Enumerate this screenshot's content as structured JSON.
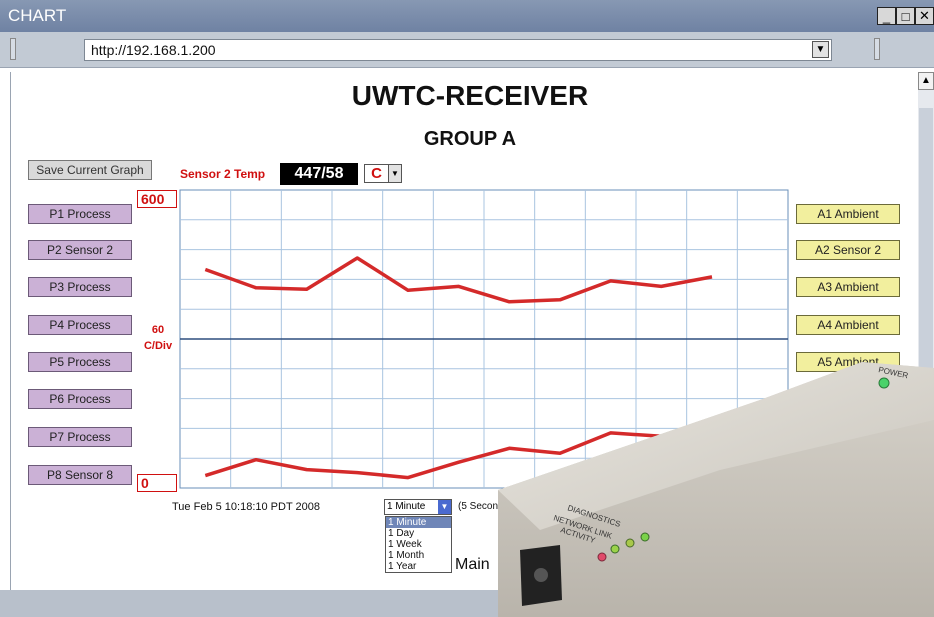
{
  "window": {
    "title": "CHART",
    "controls": [
      "_",
      "□",
      "✕"
    ],
    "address": "http://192.168.1.200"
  },
  "page": {
    "title": "UWTC-RECEIVER",
    "subtitle": "GROUP A",
    "save_button": "Save Current Graph",
    "sensor_label": "Sensor 2 Temp",
    "sensor_value": "447/58",
    "unit": "C",
    "y_top": "600",
    "y_bottom": "0",
    "y_div_value": "60",
    "y_div_unit": "C/Div",
    "timestamp": "Tue Feb 5 10:18:10 PDT 2008",
    "range_selected": "1 Minute",
    "range_note": "(5 Seconds/Div)",
    "range_options": [
      "1 Minute",
      "1 Day",
      "1 Week",
      "1 Month",
      "1 Year"
    ],
    "main_link": "Main"
  },
  "left_buttons": [
    "P1 Process",
    "P2 Sensor 2",
    "P3 Process",
    "P4 Process",
    "P5 Process",
    "P6 Process",
    "P7 Process",
    "P8 Sensor 8"
  ],
  "right_buttons": [
    "A1 Ambient",
    "A2 Sensor 2",
    "A3 Ambient",
    "A4 Ambient",
    "A5 Ambient"
  ],
  "device_labels": {
    "power": "POWER",
    "diagnostics": "DIAGNOSTICS",
    "network_link": "NETWORK LINK",
    "activity": "ACTIVITY"
  },
  "colors": {
    "trace": "#d42a2a",
    "grid": "#a9c4e0",
    "process_button": "#cbb1d6",
    "ambient_button": "#f2ef9e"
  },
  "chart_data": {
    "type": "line",
    "ylim": [
      0,
      600
    ],
    "y_step": 60,
    "x_divisions": 12,
    "x_step_seconds": 5,
    "series": [
      {
        "x": [
          0,
          5,
          10,
          15,
          20,
          25,
          30,
          35,
          40,
          45,
          50
        ],
        "y": [
          440,
          403,
          400,
          463,
          398,
          406,
          375,
          379,
          417,
          406,
          425
        ]
      },
      {
        "x": [
          0,
          5,
          10,
          15,
          20,
          25,
          30,
          35,
          40,
          45,
          50
        ],
        "y": [
          25,
          57,
          37,
          31,
          21,
          52,
          80,
          70,
          111,
          104,
          113
        ]
      }
    ]
  }
}
